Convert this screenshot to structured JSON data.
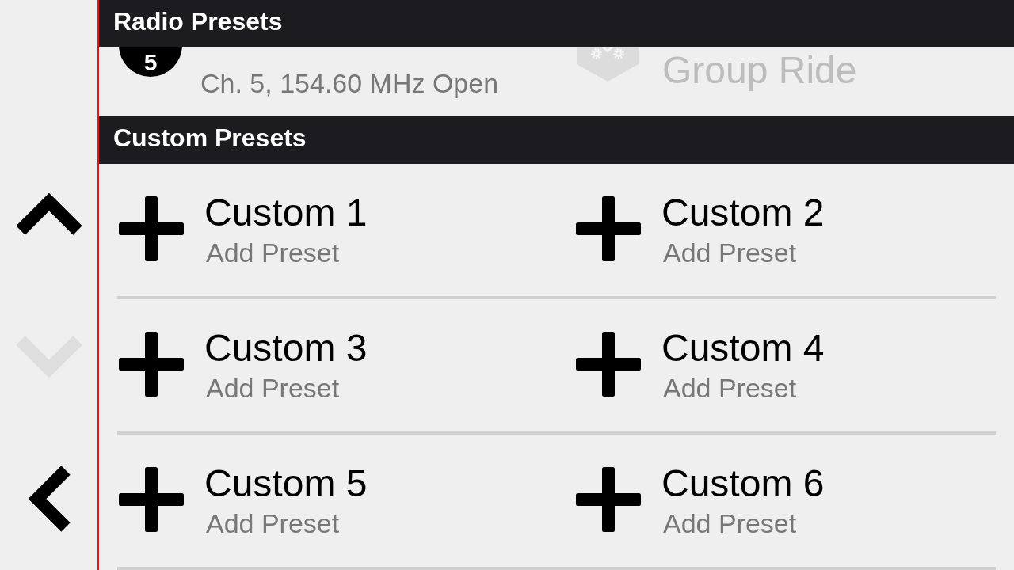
{
  "sidebar": {
    "buttons": [
      {
        "kind": "up",
        "disabled": false
      },
      {
        "kind": "down",
        "disabled": true
      },
      {
        "kind": "back",
        "disabled": false
      }
    ]
  },
  "radio_presets": {
    "title": "Radio Presets",
    "items": [
      {
        "kind": "channel",
        "number": "5",
        "subtitle": "Ch. 5, 154.60 MHz Open",
        "disabled": false
      },
      {
        "kind": "group",
        "title": "Group Ride",
        "disabled": true
      }
    ]
  },
  "custom_presets": {
    "title": "Custom Presets",
    "items": [
      {
        "title": "Custom 1",
        "subtitle": "Add Preset"
      },
      {
        "title": "Custom 2",
        "subtitle": "Add Preset"
      },
      {
        "title": "Custom 3",
        "subtitle": "Add Preset"
      },
      {
        "title": "Custom 4",
        "subtitle": "Add Preset"
      },
      {
        "title": "Custom 5",
        "subtitle": "Add Preset"
      },
      {
        "title": "Custom 6",
        "subtitle": "Add Preset"
      }
    ]
  }
}
